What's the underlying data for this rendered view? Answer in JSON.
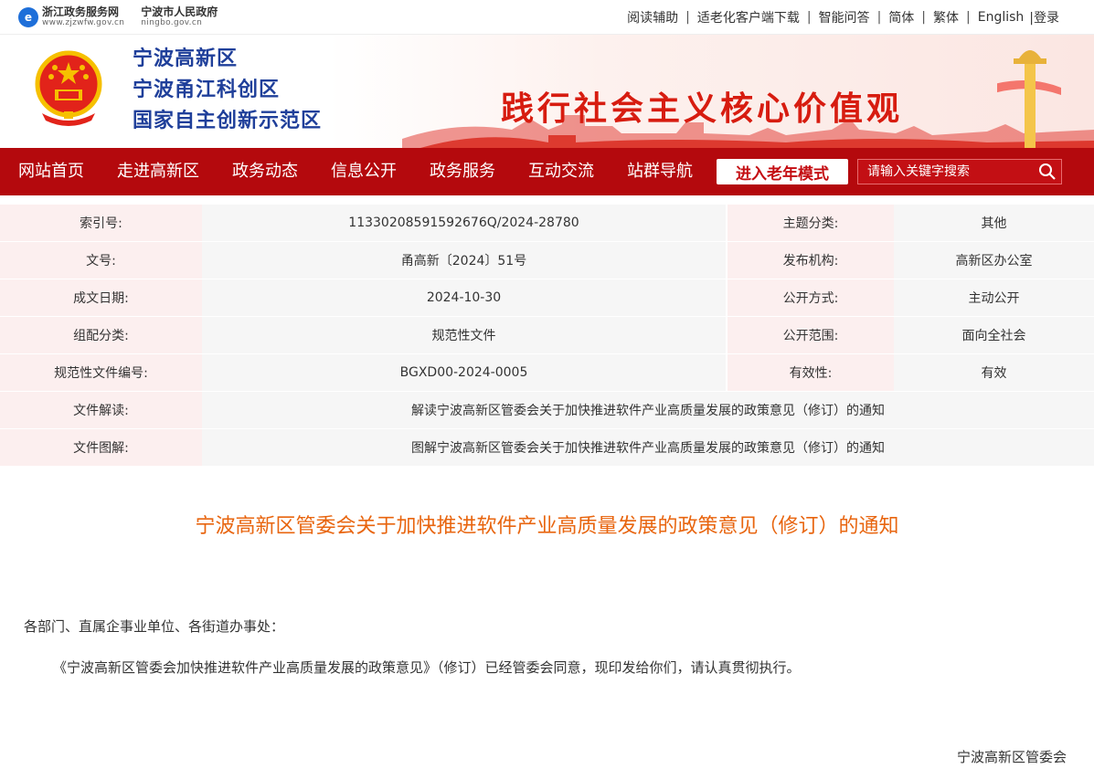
{
  "top": {
    "zj_logo_name": "浙江政务服务网",
    "zj_logo_url": "www.zjzwfw.gov.cn",
    "nb_logo_name": "宁波市人民政府",
    "nb_logo_url": "ningbo.gov.cn",
    "links": [
      "阅读辅助",
      "适老化客户端下载",
      "智能问答",
      "简体",
      "繁体",
      "English"
    ],
    "login": "|登录"
  },
  "banner": {
    "titles": [
      "宁波高新区",
      "宁波甬江科创区",
      "国家自主创新示范区"
    ],
    "slogan": "践行社会主义核心价值观"
  },
  "nav": {
    "items": [
      "网站首页",
      "走进高新区",
      "政务动态",
      "信息公开",
      "政务服务",
      "互动交流",
      "站群导航"
    ],
    "elder_mode": "进入老年模式",
    "search_placeholder": "请输入关键字搜索"
  },
  "meta": {
    "index_label": "索引号:",
    "index_value": "11330208591592676Q/2024-28780",
    "topic_label": "主题分类:",
    "topic_value": "其他",
    "docno_label": "文号:",
    "docno_value": "甬高新〔2024〕51号",
    "publisher_label": "发布机构:",
    "publisher_value": "高新区办公室",
    "date_label": "成文日期:",
    "date_value": "2024-10-30",
    "method_label": "公开方式:",
    "method_value": "主动公开",
    "category_label": "组配分类:",
    "category_value": "规范性文件",
    "scope_label": "公开范围:",
    "scope_value": "面向全社会",
    "normno_label": "规范性文件编号:",
    "normno_value": "BGXD00-2024-0005",
    "validity_label": "有效性:",
    "validity_value": "有效",
    "interp_label": "文件解读:",
    "interp_value": "解读宁波高新区管委会关于加快推进软件产业高质量发展的政策意见（修订）的通知",
    "graphic_label": "文件图解:",
    "graphic_value": "图解宁波高新区管委会关于加快推进软件产业高质量发展的政策意见（修订）的通知"
  },
  "article": {
    "title": "宁波高新区管委会关于加快推进软件产业高质量发展的政策意见（修订）的通知",
    "salutation": "各部门、直属企事业单位、各街道办事处：",
    "body": "《宁波高新区管委会加快推进软件产业高质量发展的政策意见》（修订）已经管委会同意，现印发给你们，请认真贯彻执行。",
    "signature": "宁波高新区管委会"
  },
  "colors": {
    "nav_red": "#b4090d",
    "title_orange": "#e8650f",
    "banner_blue": "#1f3f9a",
    "slogan_red": "#d71c10"
  }
}
